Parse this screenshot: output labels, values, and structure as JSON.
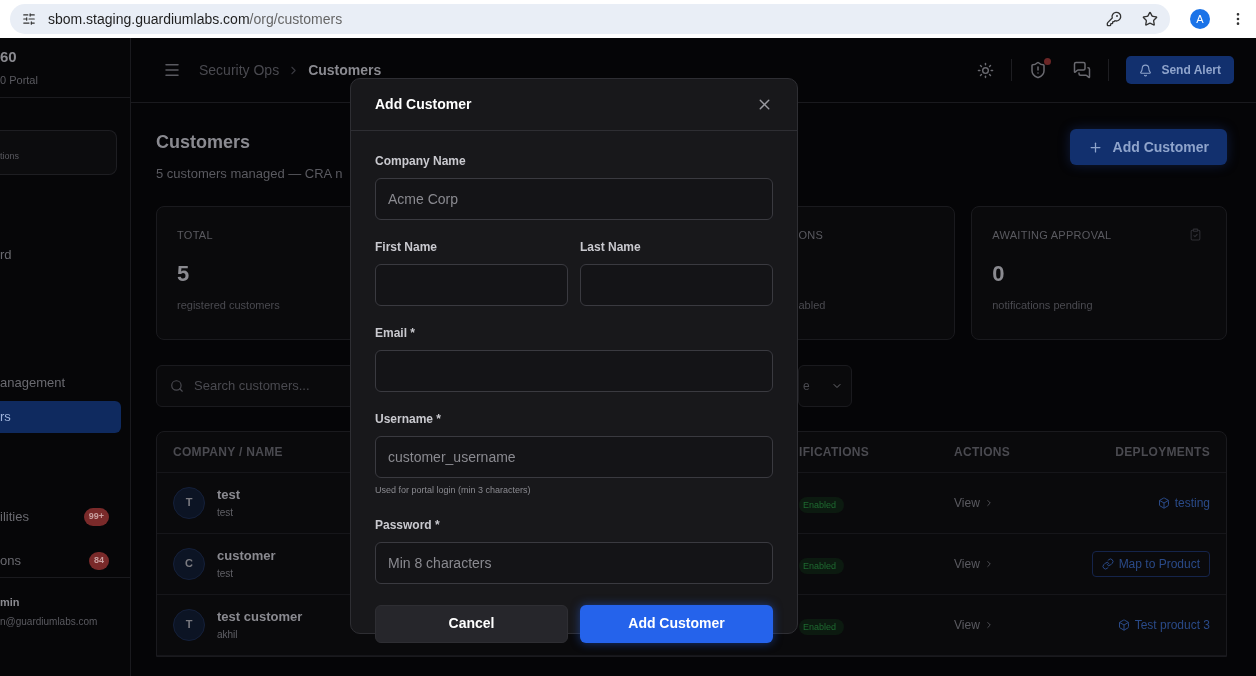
{
  "browser": {
    "url_host": "sbom.staging.guardiumlabs.com",
    "url_path": "/org/customers",
    "avatar": "A"
  },
  "sidebar": {
    "brand": "60",
    "subtitle": "0 Portal",
    "org_card_text": "tions",
    "items": [
      {
        "label": "rd",
        "selected": false
      },
      {
        "label": "anagement",
        "selected": false
      },
      {
        "label": "rs",
        "selected": true
      },
      {
        "label": "ilities",
        "selected": false,
        "badge": "99+"
      },
      {
        "label": "ons",
        "selected": false,
        "badge": "84"
      }
    ],
    "user": {
      "name": "min",
      "email": "n@guardiumlabs.com"
    }
  },
  "header": {
    "breadcrumb": [
      "Security Ops",
      "Customers"
    ],
    "alert_dot": true,
    "send_alert": "Send Alert"
  },
  "page": {
    "title": "Customers",
    "subtitle": "5 customers managed — CRA n",
    "add_button": "Add Customer",
    "stats": [
      {
        "label": "TOTAL",
        "value": "5",
        "caption": "registered customers"
      },
      {
        "label": "ONS",
        "caption": "abled"
      },
      {
        "label": "AWAITING APPROVAL",
        "value": "0",
        "caption": "notifications pending"
      }
    ],
    "search_placeholder": "Search customers...",
    "filter_value": "e"
  },
  "table": {
    "columns": [
      "COMPANY / NAME",
      "IFICATIONS",
      "ACTIONS",
      "DEPLOYMENTS"
    ],
    "rows": [
      {
        "initial": "T",
        "name": "test",
        "sub": "test",
        "status": "Enabled",
        "action": "View",
        "deployment": {
          "kind": "product",
          "label": "testing"
        }
      },
      {
        "initial": "C",
        "name": "customer",
        "sub": "test",
        "status": "Enabled",
        "action": "View",
        "deployment": {
          "kind": "map",
          "label": "Map to Product"
        }
      },
      {
        "initial": "T",
        "name": "test customer",
        "sub": "akhil",
        "status": "Enabled",
        "action": "View",
        "deployment": {
          "kind": "product",
          "label": "Test product 3"
        }
      }
    ]
  },
  "dialog": {
    "title": "Add Customer",
    "field_rows": [
      [
        {
          "label": "Company Name",
          "placeholder": "Acme Corp"
        }
      ],
      [
        {
          "label": "First Name"
        },
        {
          "label": "Last Name"
        }
      ],
      [
        {
          "label": "Email *"
        }
      ],
      [
        {
          "label": "Username *",
          "placeholder": "customer_username",
          "hint": "Used for portal login (min 3 characters)"
        }
      ],
      [
        {
          "label": "Password *",
          "placeholder": "Min 8 characters"
        }
      ]
    ],
    "cancel": "Cancel",
    "submit": "Add Customer"
  }
}
